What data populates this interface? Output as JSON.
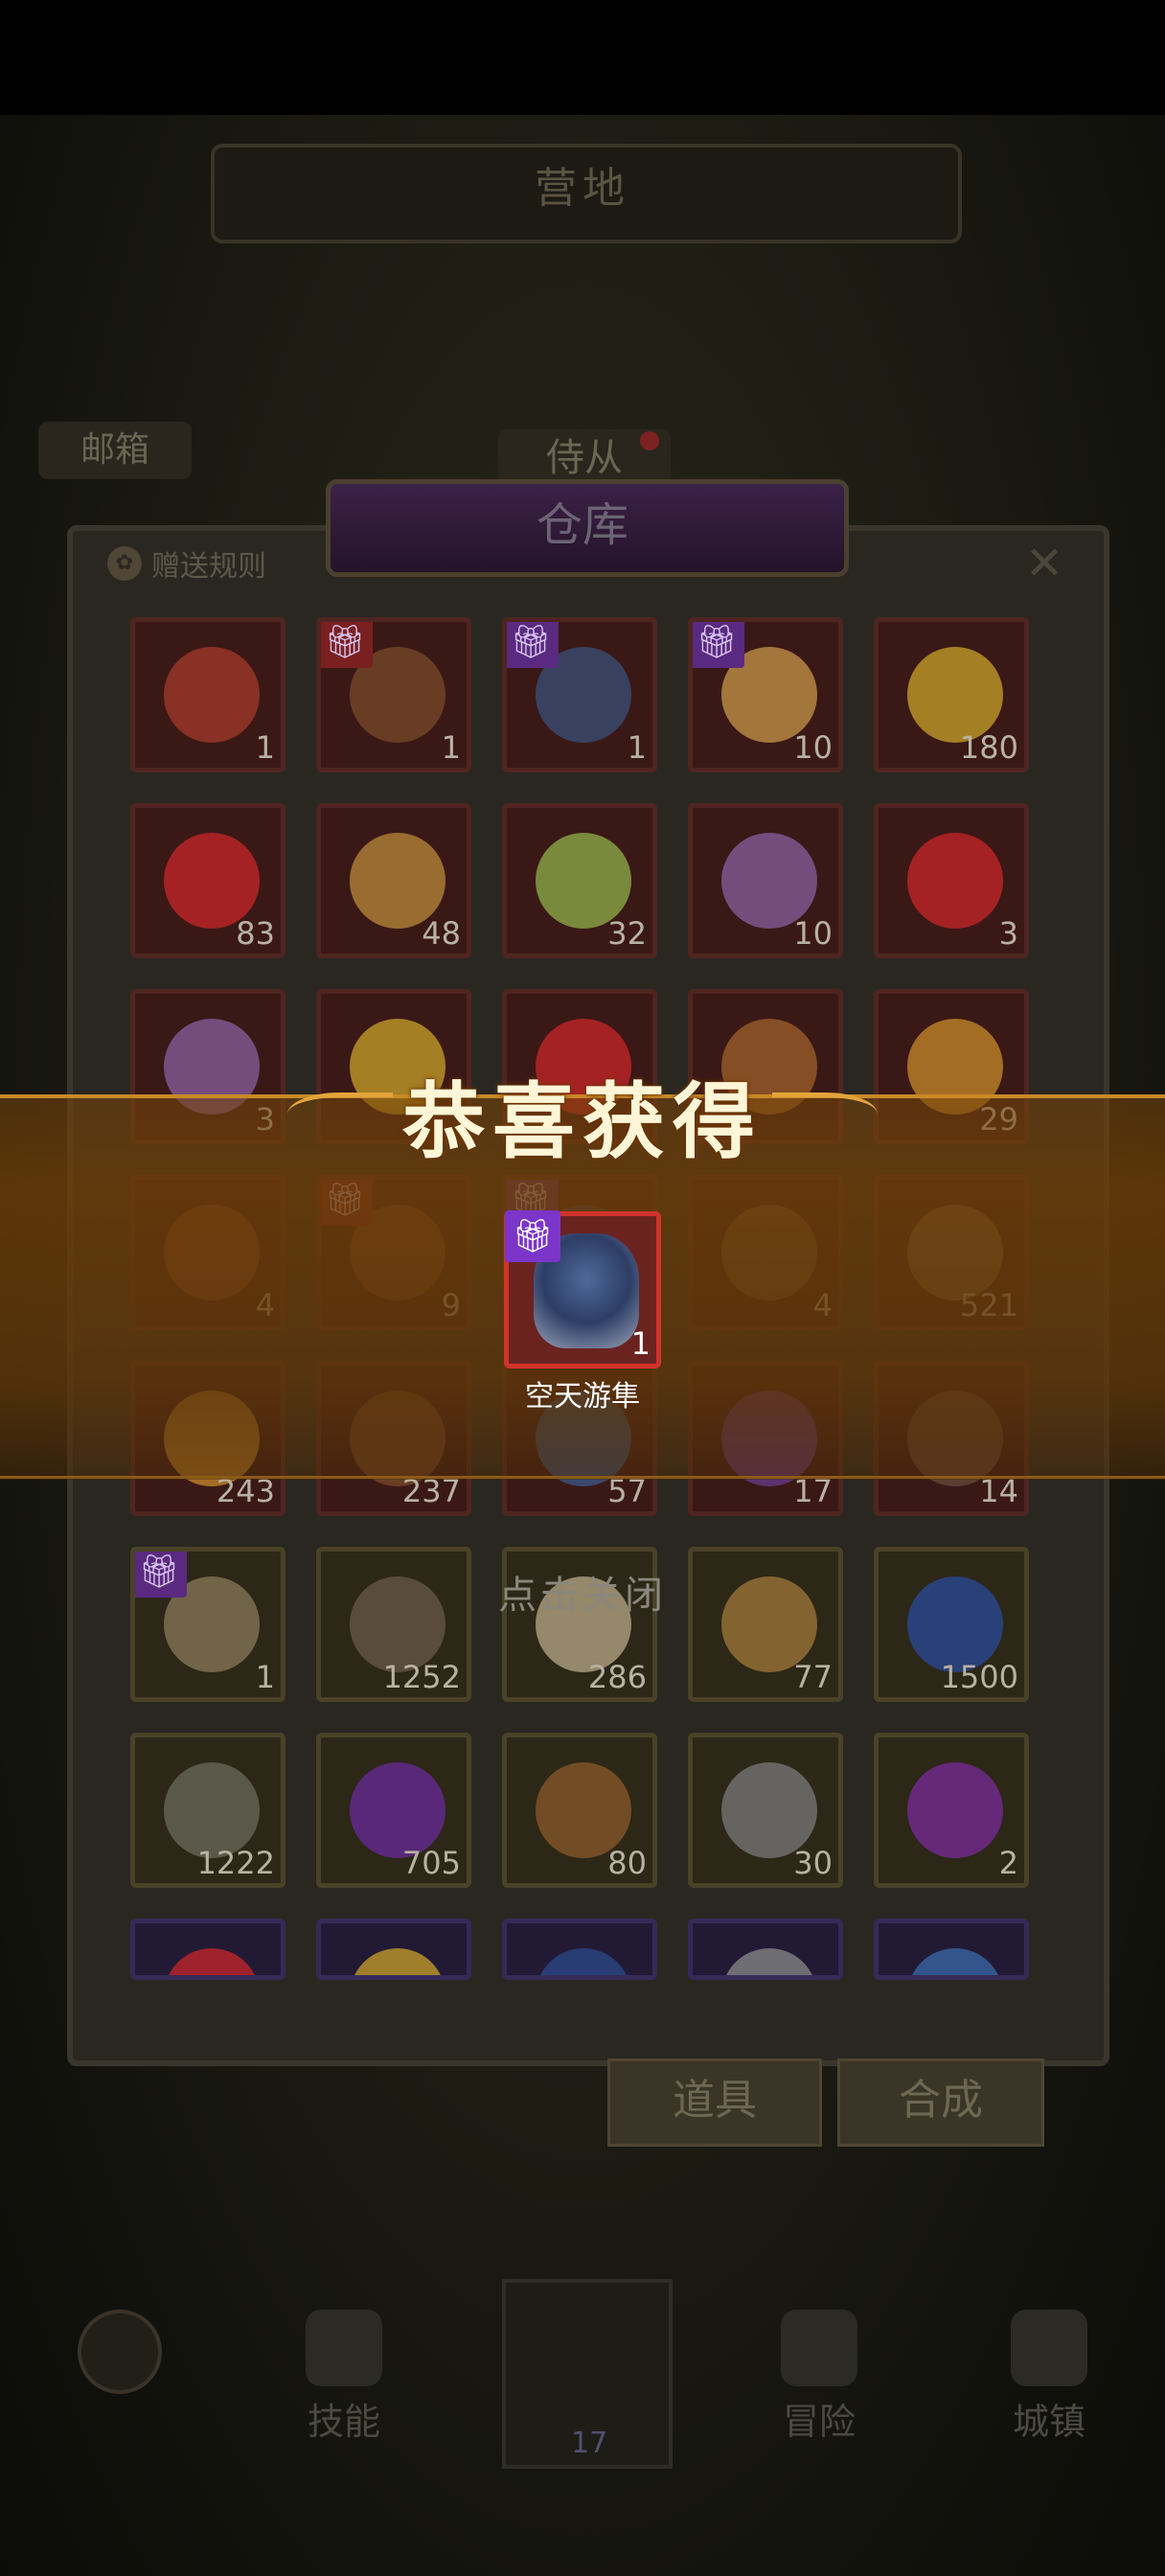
{
  "scene": {
    "top_title": "营地",
    "mailbox": "邮箱",
    "attendant": "侍从"
  },
  "warehouse": {
    "title": "仓库",
    "gift_rules": "赠送规则",
    "close_icon": "close-icon",
    "slots": [
      {
        "qty": "1",
        "frame": "red",
        "gift": false,
        "art": "#a33a2a",
        "icon": "key-icon"
      },
      {
        "qty": "1",
        "frame": "red",
        "gift": "red",
        "art": "#7a4a2a",
        "icon": "treasure-chest-icon"
      },
      {
        "qty": "1",
        "frame": "red",
        "gift": "purple",
        "art": "#3a4f7a",
        "icon": "hero-portrait-icon"
      },
      {
        "qty": "10",
        "frame": "red",
        "gift": "purple",
        "art": "#c7954a",
        "icon": "hero-portrait-icon"
      },
      {
        "qty": "180",
        "frame": "red",
        "gift": false,
        "art": "#c9a12a",
        "icon": "golden-mask-icon"
      },
      {
        "qty": "83",
        "frame": "red",
        "gift": false,
        "art": "#c8262a",
        "icon": "red-gem-icon"
      },
      {
        "qty": "48",
        "frame": "red",
        "gift": false,
        "art": "#b98a3a",
        "icon": "feather-icon"
      },
      {
        "qty": "32",
        "frame": "red",
        "gift": false,
        "art": "#8fb04a",
        "icon": "green-orb-icon"
      },
      {
        "qty": "10",
        "frame": "red",
        "gift": false,
        "art": "#8a5fa0",
        "icon": "crystal-icon"
      },
      {
        "qty": "3",
        "frame": "red",
        "gift": false,
        "art": "#c8262a",
        "icon": "red-gem-icon"
      },
      {
        "qty": "3",
        "frame": "red",
        "gift": false,
        "art": "#8a5fa0",
        "icon": "crystal-icon"
      },
      {
        "qty": "",
        "frame": "red",
        "gift": false,
        "art": "#c9a12a",
        "icon": "yellow-crystal-icon"
      },
      {
        "qty": "",
        "frame": "red",
        "gift": false,
        "art": "#c8262a",
        "icon": "red-crystal-icon"
      },
      {
        "qty": "",
        "frame": "red",
        "gift": false,
        "art": "#a0602a",
        "icon": "amulet-icon"
      },
      {
        "qty": "29",
        "frame": "red",
        "gift": false,
        "art": "#c88a2a",
        "icon": "crown-gem-icon"
      },
      {
        "qty": "4",
        "frame": "red",
        "gift": false,
        "art": "#8a4a2a",
        "icon": "key-icon"
      },
      {
        "qty": "9",
        "frame": "red",
        "gift": "red",
        "art": "#7a4a2a",
        "icon": "treasure-chest-icon"
      },
      {
        "qty": "",
        "frame": "red",
        "gift": "purple",
        "art": "#3a4f7a",
        "icon": "hero-portrait-icon"
      },
      {
        "qty": "4",
        "frame": "red",
        "gift": false,
        "art": "#7a5a3a",
        "icon": "potion-icon"
      },
      {
        "qty": "521",
        "frame": "red",
        "gift": false,
        "art": "#8a6a4a",
        "icon": "book-icon"
      },
      {
        "qty": "243",
        "frame": "red",
        "gift": false,
        "art": "#c88a2a",
        "icon": "candle-icon"
      },
      {
        "qty": "237",
        "frame": "red",
        "gift": false,
        "art": "#7a4a2a",
        "icon": "stone-icon"
      },
      {
        "qty": "57",
        "frame": "red",
        "gift": false,
        "art": "#3a5a8a",
        "icon": "shield-icon"
      },
      {
        "qty": "17",
        "frame": "red",
        "gift": false,
        "art": "#6a3a8a",
        "icon": "purple-orb-icon"
      },
      {
        "qty": "14",
        "frame": "red",
        "gift": false,
        "art": "#6a4a3a",
        "icon": "rock-icon"
      },
      {
        "qty": "1",
        "frame": "gold",
        "gift": "purple",
        "art": "#8a7a5a",
        "icon": "scroll-machine-icon"
      },
      {
        "qty": "1252",
        "frame": "gold",
        "gift": false,
        "art": "#6a5a4a",
        "icon": "hourglass-scroll-icon"
      },
      {
        "qty": "286",
        "frame": "gold",
        "gift": false,
        "art": "#b8aa88",
        "icon": "map-scroll-icon"
      },
      {
        "qty": "77",
        "frame": "gold",
        "gift": false,
        "art": "#a07a3a",
        "icon": "hammer-icon"
      },
      {
        "qty": "1500",
        "frame": "gold",
        "gift": false,
        "art": "#2a4a9a",
        "icon": "flag-icon"
      },
      {
        "qty": "1222",
        "frame": "gold",
        "gift": false,
        "art": "#6a6a5a",
        "icon": "compass-icon"
      },
      {
        "qty": "705",
        "frame": "gold",
        "gift": false,
        "art": "#6a2a9a",
        "icon": "purple-potion-icon"
      },
      {
        "qty": "80",
        "frame": "gold",
        "gift": false,
        "art": "#8a5a2a",
        "icon": "voodoo-doll-icon"
      },
      {
        "qty": "30",
        "frame": "gold",
        "gift": false,
        "art": "#7a7a7a",
        "icon": "crossed-swords-coin-icon"
      },
      {
        "qty": "2",
        "frame": "gold",
        "gift": false,
        "art": "#7a2a9a",
        "icon": "purple-rune-icon"
      },
      {
        "qty": "",
        "frame": "purple",
        "gift": false,
        "art": "#c8262a",
        "icon": "red-crystal-icon"
      },
      {
        "qty": "",
        "frame": "purple",
        "gift": false,
        "art": "#c9a12a",
        "icon": "yellow-crystal-icon"
      },
      {
        "qty": "",
        "frame": "purple",
        "gift": false,
        "art": "#2a4a8a",
        "icon": "potion-icon"
      },
      {
        "qty": "",
        "frame": "purple",
        "gift": false,
        "art": "#8a8a8a",
        "icon": "coin-icon"
      },
      {
        "qty": "",
        "frame": "purple",
        "gift": false,
        "art": "#3a6aaa",
        "icon": "blue-crystal-icon"
      }
    ],
    "tabs": {
      "items": "道具",
      "craft": "合成"
    }
  },
  "nav": {
    "skills": "技能",
    "adventure": "冒险",
    "town": "城镇",
    "center_count": "17"
  },
  "reward": {
    "title": "恭喜获得",
    "item_name": "空天游隼",
    "item_qty": "1",
    "gift_icon": "gift-icon",
    "tap_to_close": "点击关闭"
  },
  "colors": {
    "reward_band": "#8a520c",
    "reward_frame": "#d0332a",
    "gift_badge": "#7b35c8"
  }
}
